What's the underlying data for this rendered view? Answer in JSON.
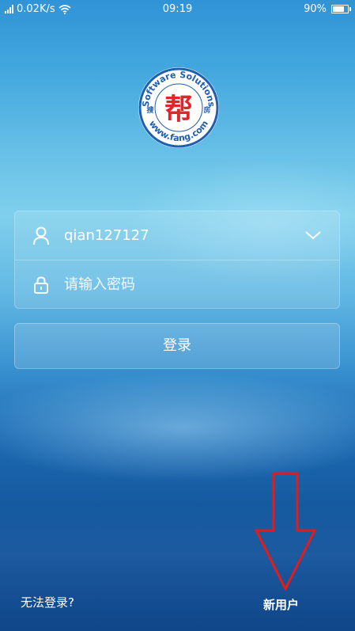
{
  "status_bar": {
    "network_speed": "0.02K/s",
    "time": "09:19",
    "battery_percent": "90%",
    "battery_level": 0.9,
    "icons": [
      "signal-icon",
      "wifi-icon",
      "battery-icon"
    ]
  },
  "logo": {
    "ring_text_top": "Software Solutions",
    "ring_text_bottom": "www.fang.com",
    "center_char": "帮",
    "side_left": "搜",
    "side_right": "房",
    "colors": {
      "ring": "#1f5fb0",
      "center": "#e0262a"
    }
  },
  "login": {
    "username_value": "qian127127",
    "password_placeholder": "请输入密码",
    "submit_label": "登录",
    "icons": {
      "user": "user-icon",
      "lock": "lock-icon",
      "dropdown": "chevron-down-icon"
    }
  },
  "footer": {
    "cant_login": "无法登录?",
    "new_user": "新用户"
  },
  "annotation": {
    "arrow_color": "#e21c1c",
    "icon": "arrow-down-icon"
  }
}
